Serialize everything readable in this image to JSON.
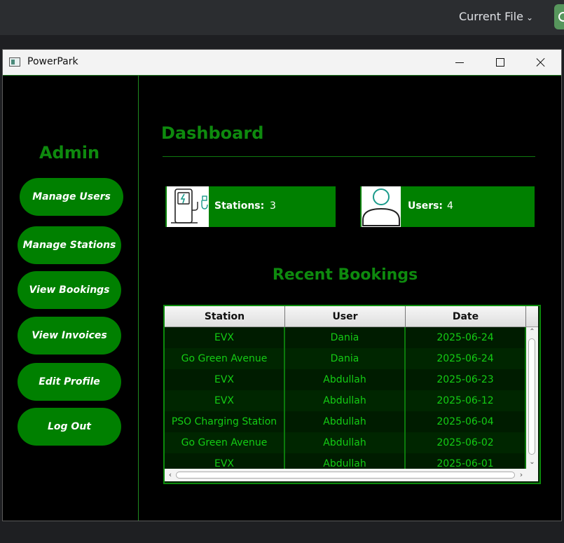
{
  "ide": {
    "current_file_label": "Current File"
  },
  "window": {
    "title": "PowerPark"
  },
  "sidebar": {
    "heading": "Admin",
    "items": [
      {
        "label": "Manage Users"
      },
      {
        "label": "Manage Stations"
      },
      {
        "label": "View Bookings"
      },
      {
        "label": "View Invoices"
      },
      {
        "label": "Edit Profile"
      },
      {
        "label": "Log Out"
      }
    ]
  },
  "main": {
    "title": "Dashboard",
    "stats": {
      "stations": {
        "label": "Stations:",
        "value": "3",
        "icon": "ev-charger-icon"
      },
      "users": {
        "label": "Users:",
        "value": "4",
        "icon": "user-icon"
      }
    },
    "recent_title": "Recent Bookings",
    "table": {
      "columns": [
        "Station",
        "User",
        "Date"
      ],
      "rows": [
        [
          "EVX",
          "Dania",
          "2025-06-24"
        ],
        [
          "Go Green Avenue",
          "Dania",
          "2025-06-24"
        ],
        [
          "EVX",
          "Abdullah",
          "2025-06-23"
        ],
        [
          "EVX",
          "Abdullah",
          "2025-06-12"
        ],
        [
          "PSO Charging Station",
          "Abdullah",
          "2025-06-04"
        ],
        [
          "Go Green Avenue",
          "Abdullah",
          "2025-06-02"
        ],
        [
          "EVX",
          "Abdullah",
          "2025-06-01"
        ]
      ]
    }
  },
  "colors": {
    "accent_green": "#008000",
    "heading_green": "#0e8a0e",
    "table_text": "#14cc14",
    "window_bg": "#000000"
  }
}
